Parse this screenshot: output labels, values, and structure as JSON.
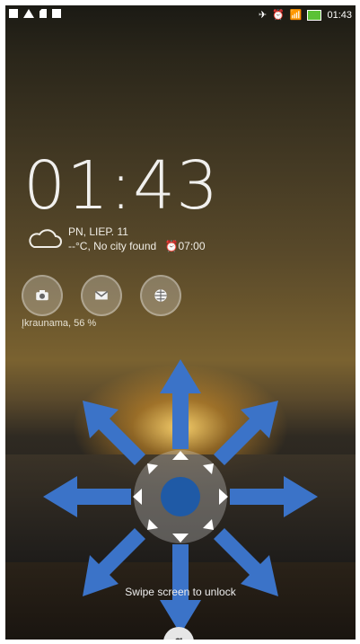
{
  "status": {
    "time": "01:43",
    "icons_left": [
      "screenshot-icon",
      "warning-icon",
      "sim-icon",
      "file-icon"
    ],
    "icons_right": [
      "airplane-icon",
      "alarm-icon",
      "wifi-icon",
      "battery-icon"
    ]
  },
  "lock": {
    "clock": "01:43",
    "weather": {
      "date": "PN, LIEP. 11",
      "line2": "--°C, No city found",
      "alarm": "07:00"
    },
    "quick_buttons": [
      "camera-icon",
      "message-icon",
      "browser-icon"
    ],
    "battery_text": "Įkraunama, 56 %",
    "hint": "Swipe screen to unlock",
    "google": "g"
  },
  "colors": {
    "arrow": "#3b73c8",
    "center": "#1f5aa6",
    "status_battery": "#5bc236"
  }
}
